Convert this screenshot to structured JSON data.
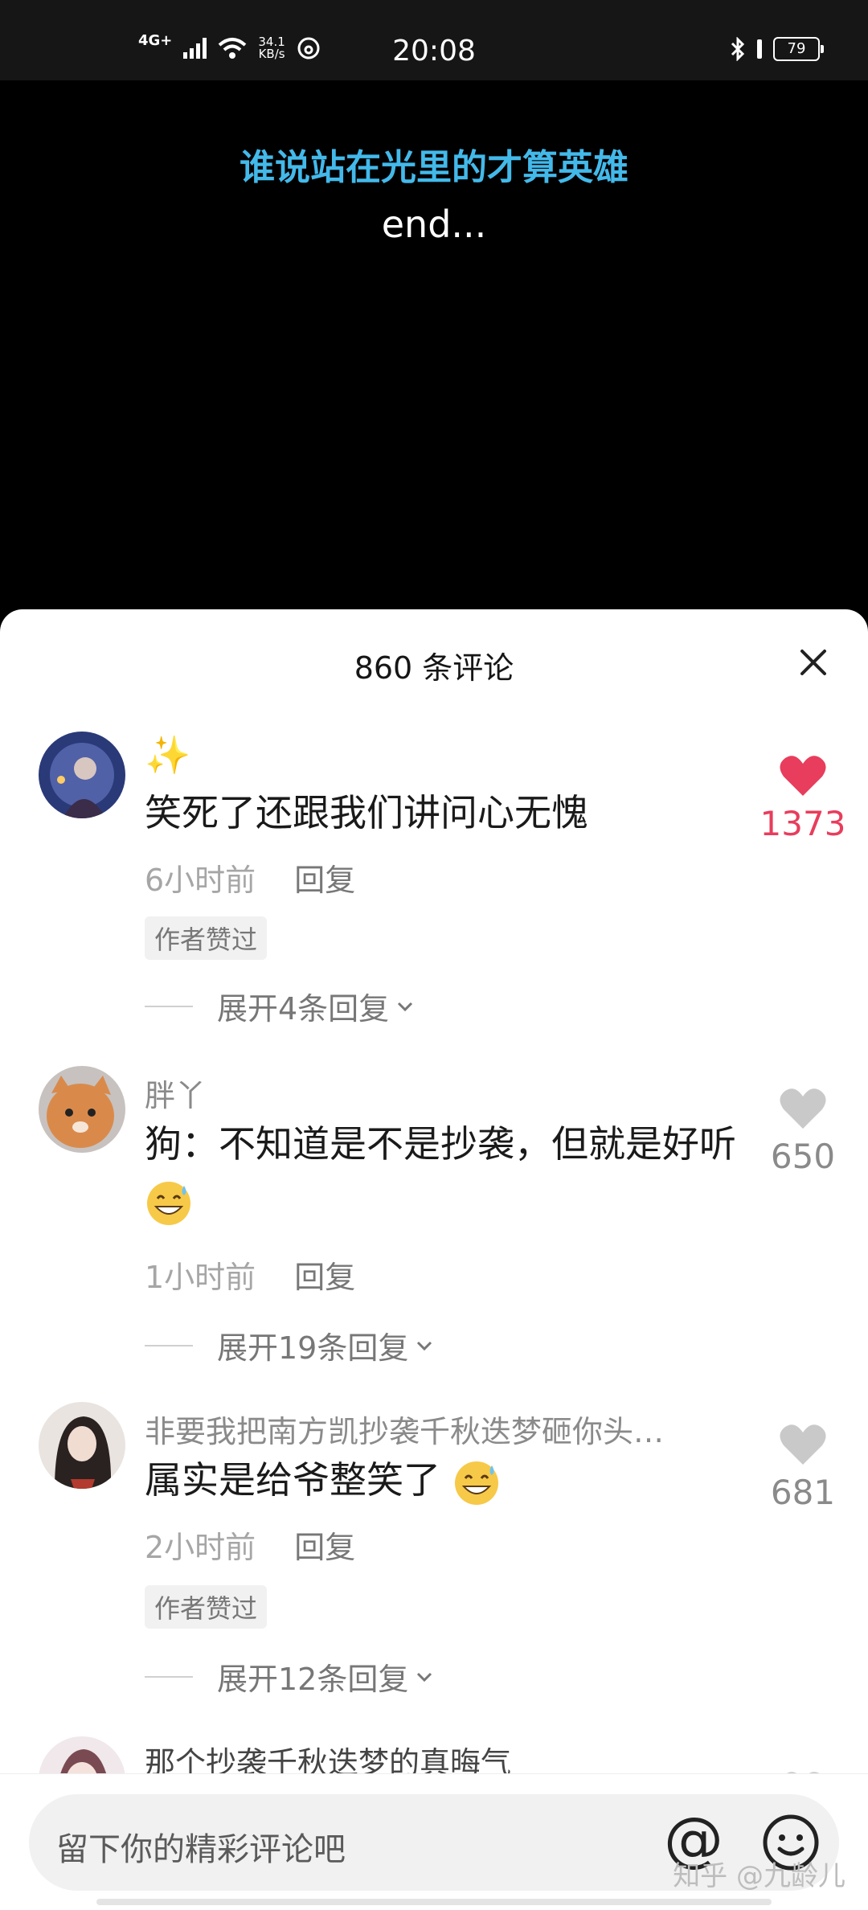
{
  "status_bar": {
    "network": "4G+",
    "speed_value": "34.1",
    "speed_unit": "KB/s",
    "time": "20:08",
    "battery": "79"
  },
  "video": {
    "lyric_line1": "谁说站在光里的才算英雄",
    "lyric_line2": "end..."
  },
  "comments_panel": {
    "title": "860 条评论",
    "input_placeholder": "留下你的精彩评论吧",
    "at_symbol": "@",
    "watermark": "知乎 @九龄儿",
    "comments": [
      {
        "username": "✨",
        "text": "笑死了还跟我们讲问心无愧",
        "time": "6小时前",
        "reply": "回复",
        "tag": "作者赞过",
        "expand": "展开4条回复",
        "likes": "1373",
        "liked": true
      },
      {
        "username": "胖丫",
        "text": "狗：不知道是不是抄袭，但就是好听",
        "time": "1小时前",
        "reply": "回复",
        "expand": "展开19条回复",
        "likes": "650",
        "liked": false
      },
      {
        "username": "非要我把南方凯抄袭千秋迭梦砸你头…",
        "text": "属实是给爷整笑了",
        "time": "2小时前",
        "reply": "回复",
        "tag": "作者赞过",
        "expand": "展开12条回复",
        "likes": "681",
        "liked": false
      },
      {
        "username": "那个抄袭千秋迭梦的真晦气"
      }
    ]
  },
  "colors": {
    "lyric_accent": "#43b9ea",
    "like_red": "#e83d5c",
    "sheet_bg": "#ffffff"
  }
}
